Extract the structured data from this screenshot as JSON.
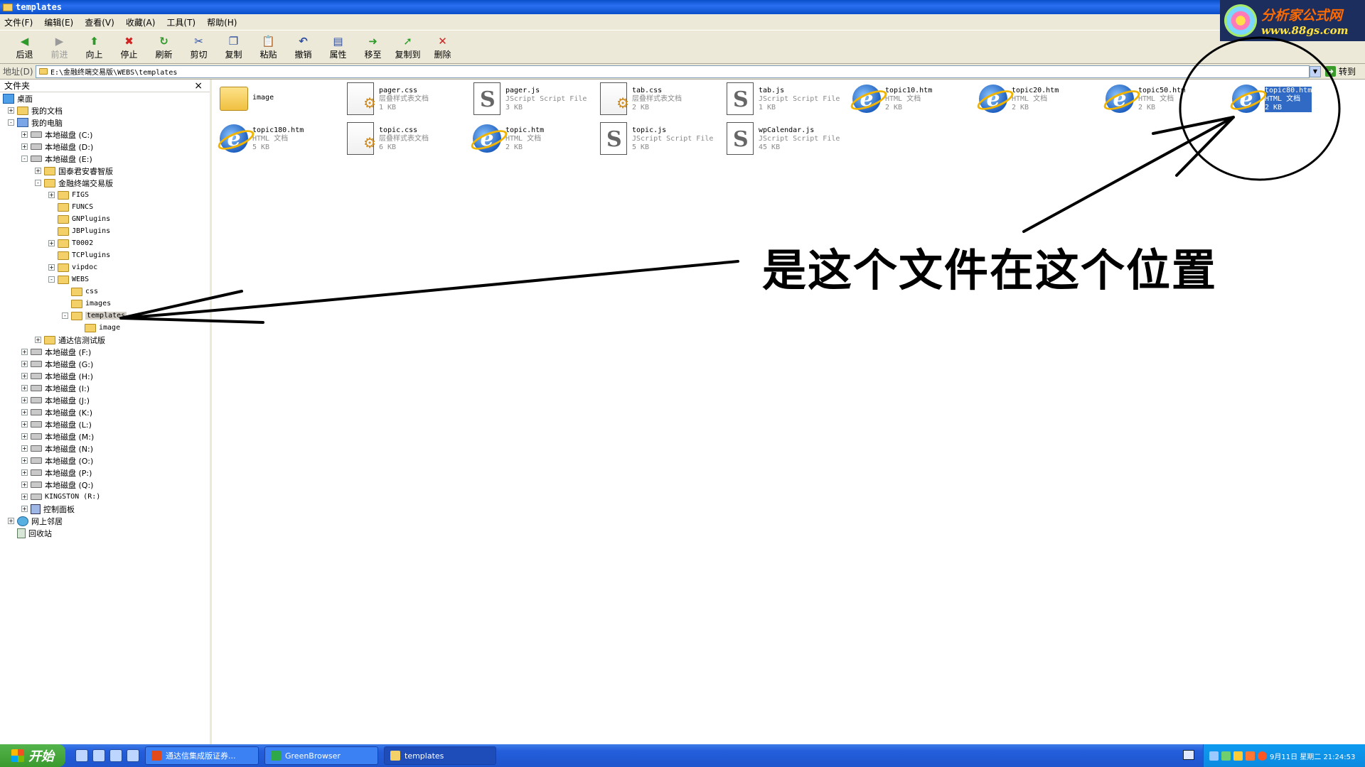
{
  "window": {
    "title": "templates"
  },
  "menu": [
    "文件(F)",
    "编辑(E)",
    "查看(V)",
    "收藏(A)",
    "工具(T)",
    "帮助(H)"
  ],
  "toolbar": [
    {
      "label": "后退",
      "icon": "back-arrow-icon",
      "glyph": "◀",
      "color": "#2e9a2a",
      "enabled": true
    },
    {
      "label": "前进",
      "icon": "forward-arrow-icon",
      "glyph": "▶",
      "color": "#9a9a9a",
      "enabled": false
    },
    {
      "label": "向上",
      "icon": "up-folder-icon",
      "glyph": "⬆",
      "color": "#2e9a2a",
      "enabled": true
    },
    {
      "label": "停止",
      "icon": "stop-icon",
      "glyph": "✖",
      "color": "#d32020",
      "enabled": true
    },
    {
      "label": "刷新",
      "icon": "refresh-icon",
      "glyph": "↻",
      "color": "#2e9a2a",
      "enabled": true
    },
    {
      "label": "剪切",
      "icon": "cut-icon",
      "glyph": "✂",
      "color": "#2c4ca0",
      "enabled": true
    },
    {
      "label": "复制",
      "icon": "copy-icon",
      "glyph": "❐",
      "color": "#2c4ca0",
      "enabled": true
    },
    {
      "label": "粘贴",
      "icon": "paste-icon",
      "glyph": "📋",
      "color": "#2c4ca0",
      "enabled": true
    },
    {
      "label": "撤销",
      "icon": "undo-icon",
      "glyph": "↶",
      "color": "#2c4ca0",
      "enabled": true
    },
    {
      "label": "属性",
      "icon": "properties-icon",
      "glyph": "▤",
      "color": "#2c4ca0",
      "enabled": true
    },
    {
      "label": "移至",
      "icon": "move-to-icon",
      "glyph": "➜",
      "color": "#2e9a2a",
      "enabled": true
    },
    {
      "label": "复制到",
      "icon": "copy-to-icon",
      "glyph": "➚",
      "color": "#2e9a2a",
      "enabled": true
    },
    {
      "label": "删除",
      "icon": "delete-icon",
      "glyph": "✕",
      "color": "#d32020",
      "enabled": true
    }
  ],
  "logo": {
    "name": "分析家公式网",
    "url": "www.88gs.com"
  },
  "address": {
    "label": "地址(D)",
    "value": "E:\\金融终端交易版\\WEBS\\templates",
    "go_label": "转到"
  },
  "folder_pane": {
    "title": "文件夹",
    "close": "×",
    "nodes": [
      {
        "label": "桌面",
        "depth": 0,
        "toggle": "",
        "icon": "desktop-icon",
        "kind": "desk"
      },
      {
        "label": "我的文档",
        "depth": 1,
        "toggle": "+",
        "icon": "my-documents-icon",
        "kind": "fold"
      },
      {
        "label": "我的电脑",
        "depth": 1,
        "toggle": "-",
        "icon": "my-computer-icon",
        "kind": "pc"
      },
      {
        "label": "本地磁盘 (C:)",
        "depth": 2,
        "toggle": "+",
        "icon": "drive-icon",
        "kind": "drive"
      },
      {
        "label": "本地磁盘 (D:)",
        "depth": 2,
        "toggle": "+",
        "icon": "drive-icon",
        "kind": "drive"
      },
      {
        "label": "本地磁盘 (E:)",
        "depth": 2,
        "toggle": "-",
        "icon": "drive-icon",
        "kind": "drive"
      },
      {
        "label": "国泰君安睿智版",
        "depth": 3,
        "toggle": "+",
        "icon": "folder-icon",
        "kind": "fold"
      },
      {
        "label": "金融终端交易版",
        "depth": 3,
        "toggle": "-",
        "icon": "folder-icon",
        "kind": "fold"
      },
      {
        "label": "FIGS",
        "depth": 4,
        "toggle": "+",
        "icon": "folder-icon",
        "kind": "fold"
      },
      {
        "label": "FUNCS",
        "depth": 4,
        "toggle": "",
        "icon": "folder-icon",
        "kind": "fold"
      },
      {
        "label": "GNPlugins",
        "depth": 4,
        "toggle": "",
        "icon": "folder-icon",
        "kind": "fold"
      },
      {
        "label": "JBPlugins",
        "depth": 4,
        "toggle": "",
        "icon": "folder-icon",
        "kind": "fold"
      },
      {
        "label": "T0002",
        "depth": 4,
        "toggle": "+",
        "icon": "folder-icon",
        "kind": "fold"
      },
      {
        "label": "TCPlugins",
        "depth": 4,
        "toggle": "",
        "icon": "folder-icon",
        "kind": "fold"
      },
      {
        "label": "vipdoc",
        "depth": 4,
        "toggle": "+",
        "icon": "folder-icon",
        "kind": "fold"
      },
      {
        "label": "WEBS",
        "depth": 4,
        "toggle": "-",
        "icon": "folder-icon",
        "kind": "fold"
      },
      {
        "label": "css",
        "depth": 5,
        "toggle": "",
        "icon": "folder-icon",
        "kind": "fold"
      },
      {
        "label": "images",
        "depth": 5,
        "toggle": "",
        "icon": "folder-icon",
        "kind": "fold"
      },
      {
        "label": "templates",
        "depth": 5,
        "toggle": "-",
        "icon": "folder-open-icon",
        "kind": "fold",
        "selected": true
      },
      {
        "label": "image",
        "depth": 6,
        "toggle": "",
        "icon": "folder-icon",
        "kind": "fold"
      },
      {
        "label": "通达信测试版",
        "depth": 3,
        "toggle": "+",
        "icon": "folder-icon",
        "kind": "fold"
      },
      {
        "label": "本地磁盘 (F:)",
        "depth": 2,
        "toggle": "+",
        "icon": "drive-icon",
        "kind": "drive"
      },
      {
        "label": "本地磁盘 (G:)",
        "depth": 2,
        "toggle": "+",
        "icon": "drive-icon",
        "kind": "drive"
      },
      {
        "label": "本地磁盘 (H:)",
        "depth": 2,
        "toggle": "+",
        "icon": "drive-icon",
        "kind": "drive"
      },
      {
        "label": "本地磁盘 (I:)",
        "depth": 2,
        "toggle": "+",
        "icon": "drive-icon",
        "kind": "drive"
      },
      {
        "label": "本地磁盘 (J:)",
        "depth": 2,
        "toggle": "+",
        "icon": "drive-icon",
        "kind": "drive"
      },
      {
        "label": "本地磁盘 (K:)",
        "depth": 2,
        "toggle": "+",
        "icon": "drive-icon",
        "kind": "drive"
      },
      {
        "label": "本地磁盘 (L:)",
        "depth": 2,
        "toggle": "+",
        "icon": "drive-icon",
        "kind": "drive"
      },
      {
        "label": "本地磁盘 (M:)",
        "depth": 2,
        "toggle": "+",
        "icon": "drive-icon",
        "kind": "drive"
      },
      {
        "label": "本地磁盘 (N:)",
        "depth": 2,
        "toggle": "+",
        "icon": "drive-icon",
        "kind": "drive"
      },
      {
        "label": "本地磁盘 (O:)",
        "depth": 2,
        "toggle": "+",
        "icon": "drive-icon",
        "kind": "drive"
      },
      {
        "label": "本地磁盘 (P:)",
        "depth": 2,
        "toggle": "+",
        "icon": "drive-icon",
        "kind": "drive"
      },
      {
        "label": "本地磁盘 (Q:)",
        "depth": 2,
        "toggle": "+",
        "icon": "drive-icon",
        "kind": "drive"
      },
      {
        "label": "KINGSTON (R:)",
        "depth": 2,
        "toggle": "+",
        "icon": "removable-drive-icon",
        "kind": "drive"
      },
      {
        "label": "控制面板",
        "depth": 2,
        "toggle": "+",
        "icon": "control-panel-icon",
        "kind": "cp"
      },
      {
        "label": "网上邻居",
        "depth": 1,
        "toggle": "+",
        "icon": "network-icon",
        "kind": "net"
      },
      {
        "label": "回收站",
        "depth": 1,
        "toggle": "",
        "icon": "recycle-bin-icon",
        "kind": "bin"
      }
    ]
  },
  "files": [
    {
      "name": "image",
      "type": "",
      "size": "",
      "kind": "folder"
    },
    {
      "name": "pager.css",
      "type": "层叠样式表文档",
      "size": "1 KB",
      "kind": "css"
    },
    {
      "name": "pager.js",
      "type": "JScript Script File",
      "size": "3 KB",
      "kind": "js"
    },
    {
      "name": "tab.css",
      "type": "层叠样式表文档",
      "size": "2 KB",
      "kind": "css"
    },
    {
      "name": "tab.js",
      "type": "JScript Script File",
      "size": "1 KB",
      "kind": "js"
    },
    {
      "name": "topic10.htm",
      "type": "HTML 文档",
      "size": "2 KB",
      "kind": "htm"
    },
    {
      "name": "topic20.htm",
      "type": "HTML 文档",
      "size": "2 KB",
      "kind": "htm"
    },
    {
      "name": "topic50.htm",
      "type": "HTML 文档",
      "size": "2 KB",
      "kind": "htm"
    },
    {
      "name": "topic80.htm",
      "type": "HTML 文档",
      "size": "2 KB",
      "kind": "htm",
      "selected": true
    },
    {
      "name": "topic180.htm",
      "type": "HTML 文档",
      "size": "5 KB",
      "kind": "htm"
    },
    {
      "name": "topic.css",
      "type": "层叠样式表文档",
      "size": "6 KB",
      "kind": "css"
    },
    {
      "name": "topic.htm",
      "type": "HTML 文档",
      "size": "2 KB",
      "kind": "htm"
    },
    {
      "name": "topic.js",
      "type": "JScript Script File",
      "size": "5 KB",
      "kind": "js"
    },
    {
      "name": "wpCalendar.js",
      "type": "JScript Script File",
      "size": "45 KB",
      "kind": "js"
    }
  ],
  "annotation": {
    "text": "是这个文件在这个位置"
  },
  "taskbar": {
    "start_label": "开始",
    "tasks": [
      {
        "label": "通达信集成版证券...",
        "icon": "app-icon",
        "color": "#e24a1a"
      },
      {
        "label": "GreenBrowser",
        "icon": "browser-icon",
        "color": "#2fa84a"
      },
      {
        "label": "templates",
        "icon": "folder-icon",
        "color": "#f3d168",
        "active": true
      }
    ],
    "clock": "9月11日 星期二 21:24:53"
  }
}
